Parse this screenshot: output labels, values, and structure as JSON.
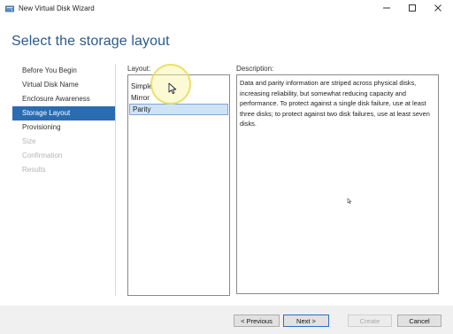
{
  "window": {
    "title": "New Virtual Disk Wizard",
    "icon": "disk-wizard-icon",
    "controls": [
      "minimize-icon",
      "maximize-icon",
      "close-icon"
    ]
  },
  "page": {
    "heading": "Select the storage layout"
  },
  "nav": {
    "items": [
      {
        "label": "Before You Begin",
        "state": "normal"
      },
      {
        "label": "Virtual Disk Name",
        "state": "normal"
      },
      {
        "label": "Enclosure Awareness",
        "state": "normal"
      },
      {
        "label": "Storage Layout",
        "state": "selected"
      },
      {
        "label": "Provisioning",
        "state": "normal"
      },
      {
        "label": "Size",
        "state": "disabled"
      },
      {
        "label": "Confirmation",
        "state": "disabled"
      },
      {
        "label": "Results",
        "state": "disabled"
      }
    ]
  },
  "layout": {
    "label": "Layout:",
    "options": [
      "Simple",
      "Mirror",
      "Parity"
    ],
    "selected": "Parity"
  },
  "description": {
    "label": "Description:",
    "text": "Data and parity information are striped across physical disks, increasing reliability, but somewhat reducing capacity and performance. To protect against a single disk failure, use at least three disks; to protect against two disk failures, use at least seven disks."
  },
  "buttons": {
    "previous": "< Previous",
    "next": "Next >",
    "create": "Create",
    "cancel": "Cancel"
  },
  "colors": {
    "heading": "#2a5a8c",
    "nav_selected": "#2b6cb0",
    "list_selected": "#cfe3f7",
    "cursor_highlight": "#f8f5a0"
  }
}
